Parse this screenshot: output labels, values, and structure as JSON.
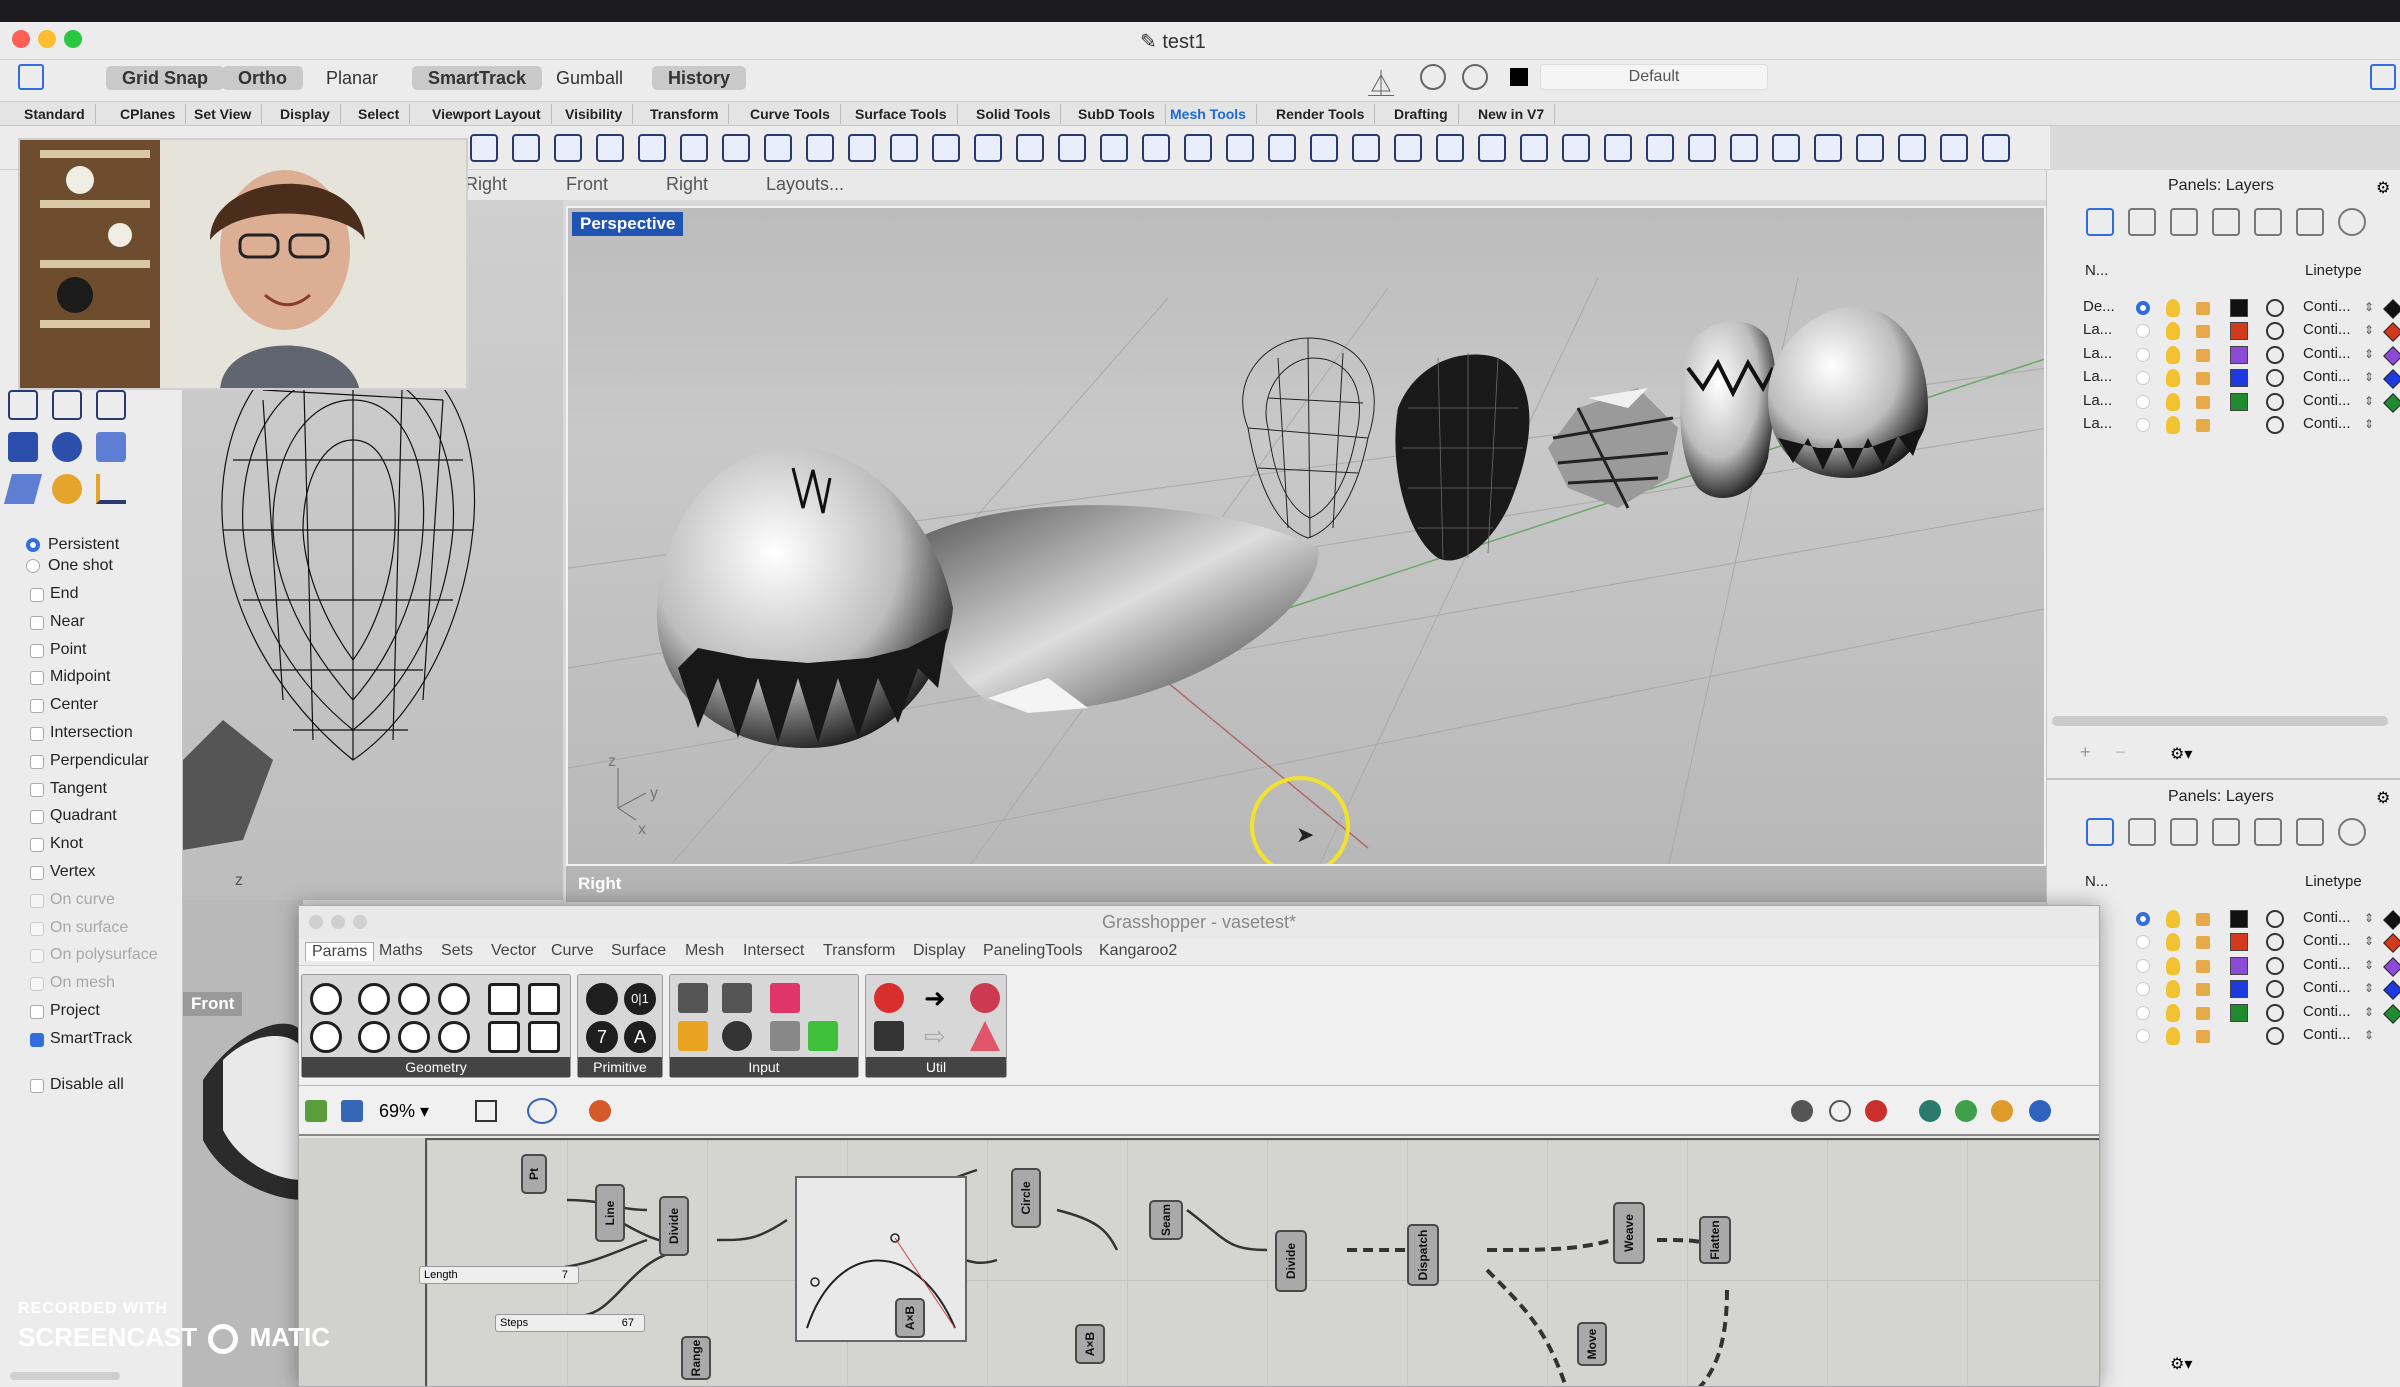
{
  "window": {
    "title": "test1"
  },
  "command_bar": {
    "toggles": [
      {
        "label": "Grid Snap",
        "on": true
      },
      {
        "label": "Ortho",
        "on": true
      },
      {
        "label": "Planar",
        "on": false
      },
      {
        "label": "SmartTrack",
        "on": true
      },
      {
        "label": "Gumball",
        "on": false
      },
      {
        "label": "History",
        "on": true
      }
    ],
    "layer_dropdown": "Default"
  },
  "ribbon_tabs": [
    "Standard",
    "CPlanes",
    "Set View",
    "Display",
    "Select",
    "Viewport Layout",
    "Visibility",
    "Transform",
    "Curve Tools",
    "Surface Tools",
    "Solid Tools",
    "SubD Tools",
    "Mesh Tools",
    "Render Tools",
    "Drafting",
    "New in V7"
  ],
  "active_ribbon_tab": "Mesh Tools",
  "viewport_tabs": [
    "Right",
    "Front",
    "Right",
    "Layouts..."
  ],
  "viewports": {
    "perspective_label": "Perspective",
    "right_label": "Right",
    "front_label": "Front"
  },
  "osnaps": {
    "mode": [
      {
        "label": "Persistent",
        "checked": true
      },
      {
        "label": "One shot",
        "checked": false
      }
    ],
    "items": [
      {
        "label": "End",
        "checked": false,
        "dim": false
      },
      {
        "label": "Near",
        "checked": false,
        "dim": false
      },
      {
        "label": "Point",
        "checked": false,
        "dim": false
      },
      {
        "label": "Midpoint",
        "checked": false,
        "dim": false
      },
      {
        "label": "Center",
        "checked": false,
        "dim": false
      },
      {
        "label": "Intersection",
        "checked": false,
        "dim": false
      },
      {
        "label": "Perpendicular",
        "checked": false,
        "dim": false
      },
      {
        "label": "Tangent",
        "checked": false,
        "dim": false
      },
      {
        "label": "Quadrant",
        "checked": false,
        "dim": false
      },
      {
        "label": "Knot",
        "checked": false,
        "dim": false
      },
      {
        "label": "Vertex",
        "checked": false,
        "dim": false
      },
      {
        "label": "On curve",
        "checked": false,
        "dim": true
      },
      {
        "label": "On surface",
        "checked": false,
        "dim": true
      },
      {
        "label": "On polysurface",
        "checked": false,
        "dim": true
      },
      {
        "label": "On mesh",
        "checked": false,
        "dim": true
      },
      {
        "label": "Project",
        "checked": false,
        "dim": false
      },
      {
        "label": "SmartTrack",
        "checked": true,
        "dim": false
      }
    ],
    "disable_all": "Disable all"
  },
  "layers_panel": {
    "title": "Panels: Layers",
    "col_name": "N...",
    "col_linetype": "Linetype",
    "rows": [
      {
        "name": "De...",
        "current": true,
        "color": "#111111",
        "linetype": "Conti...",
        "material_color": "#111111"
      },
      {
        "name": "La...",
        "current": false,
        "color": "#d23a1c",
        "linetype": "Conti...",
        "material_color": "#d23a1c"
      },
      {
        "name": "La...",
        "current": false,
        "color": "#8c4bd6",
        "linetype": "Conti...",
        "material_color": "#8c4bd6"
      },
      {
        "name": "La...",
        "current": false,
        "color": "#1c3ae0",
        "linetype": "Conti...",
        "material_color": "#1c3ae0"
      },
      {
        "name": "La...",
        "current": false,
        "color": "#1f8a2f",
        "linetype": "Conti...",
        "material_color": "#1f8a2f"
      },
      {
        "name": "La...",
        "current": false,
        "color": "#ffffff",
        "linetype": "Conti...",
        "material_color": ""
      }
    ],
    "add_label": "+",
    "remove_label": "−"
  },
  "grasshopper": {
    "title": "Grasshopper - vasetest*",
    "menu_tabs": [
      "Params",
      "Maths",
      "Sets",
      "Vector",
      "Curve",
      "Surface",
      "Mesh",
      "Intersect",
      "Transform",
      "Display",
      "PanelingTools",
      "Kangaroo2"
    ],
    "active_tab": "Params",
    "groups": [
      "Geometry",
      "Primitive",
      "Input",
      "Util"
    ],
    "zoom": "69%",
    "components": [
      "Pt",
      "Line",
      "Divide",
      "Circle",
      "Seam",
      "Divide",
      "Dispatch",
      "Weave",
      "Flatten",
      "A×B",
      "A×B",
      "Move",
      "Range"
    ],
    "sliders": [
      {
        "label": "Length",
        "value": "7"
      },
      {
        "label": "Steps",
        "value": "67"
      }
    ],
    "params_glyphs": [
      "7",
      "A",
      "0|1"
    ]
  },
  "watermark": {
    "line1": "RECORDED WITH",
    "line2_a": "SCREENCAST",
    "line2_b": "MATIC"
  },
  "axis_labels": {
    "z": "z",
    "y": "y",
    "x": "x"
  },
  "colors": {
    "accent": "#2f6de0",
    "active_tab": "#1b6ad8",
    "cursor_highlight": "#f2e22e"
  }
}
